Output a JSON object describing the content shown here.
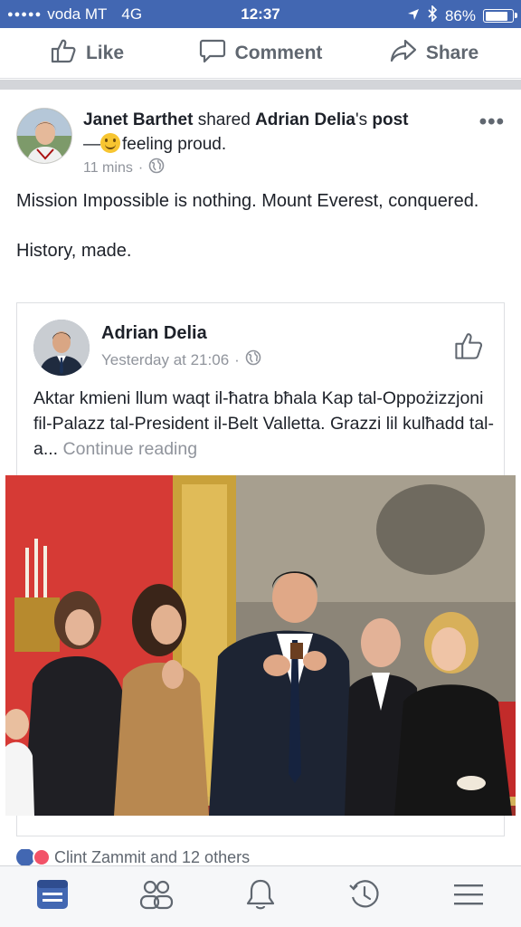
{
  "status_bar": {
    "signal_dots": "●●●●●",
    "carrier": "voda MT",
    "network": "4G",
    "time": "12:37",
    "battery_text": "86%",
    "battery_level": 0.86
  },
  "action_bar": {
    "like_label": "Like",
    "comment_label": "Comment",
    "share_label": "Share"
  },
  "post": {
    "author": "Janet Barthet",
    "shared_text": " shared ",
    "original_author": "Adrian Delia",
    "post_suffix": "'s post",
    "post_word": "post",
    "dash": "—",
    "feeling": "feeling proud.",
    "time": "11 mins",
    "dot": "·",
    "more": "•••",
    "body_line1": "Mission Impossible is nothing. Mount Everest, conquered.",
    "body_line2": "History, made."
  },
  "shared": {
    "author": "Adrian Delia",
    "time": "Yesterday at 21:06",
    "dot": "·",
    "text": "Aktar kmieni llum waqt il-ħatra bħala Kap tal-Oppożizzjoni fil-Palazz tal-President il-Belt Valletta. Grazzi lil kulħadd tal-a...",
    "continue": "Continue reading"
  },
  "reactions": {
    "text": "Clint Zammit and 12 others"
  },
  "tab_bar": {
    "tabs": [
      "news-feed",
      "friends",
      "notifications",
      "history",
      "menu"
    ]
  },
  "colors": {
    "brand_blue": "#4267b2",
    "meta_gray": "#90949c",
    "action_gray": "#606770"
  }
}
